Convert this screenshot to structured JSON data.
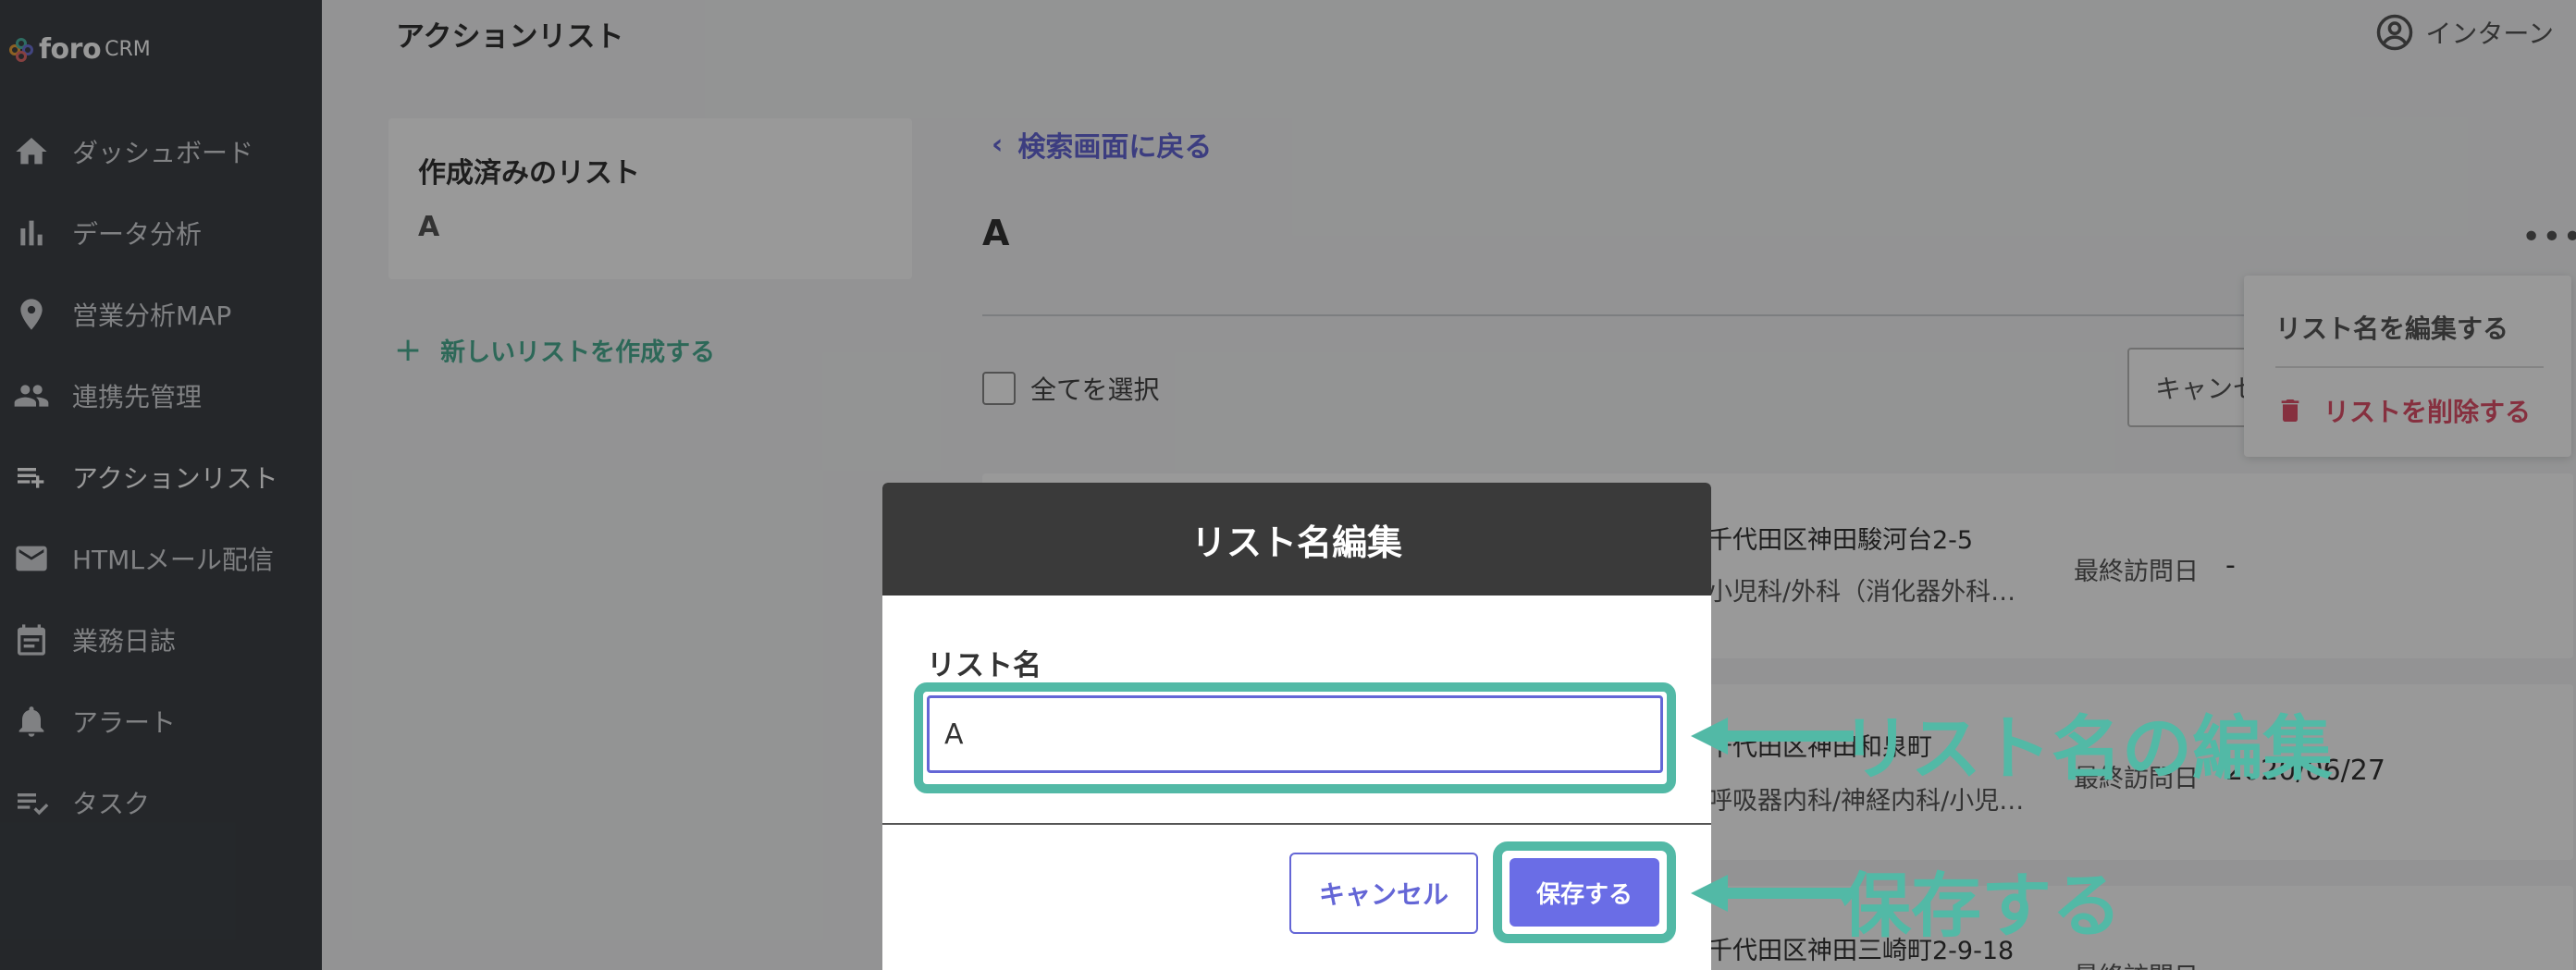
{
  "app": {
    "logo_text": "foro",
    "logo_sub": "CRM"
  },
  "sidebar": {
    "items": [
      {
        "label": "ダッシュボード",
        "icon": "home-icon"
      },
      {
        "label": "データ分析",
        "icon": "bar-chart-icon"
      },
      {
        "label": "営業分析MAP",
        "icon": "map-pin-icon"
      },
      {
        "label": "連携先管理",
        "icon": "people-icon"
      },
      {
        "label": "アクションリスト",
        "icon": "playlist-add-icon"
      },
      {
        "label": "HTMLメール配信",
        "icon": "mail-icon"
      },
      {
        "label": "業務日誌",
        "icon": "calendar-icon"
      },
      {
        "label": "アラート",
        "icon": "bell-icon"
      },
      {
        "label": "タスク",
        "icon": "checklist-icon"
      }
    ]
  },
  "header": {
    "title": "アクションリスト",
    "user": "インターン"
  },
  "left_panel": {
    "title": "作成済みのリスト",
    "item": "A",
    "new_list": "新しいリストを作成する"
  },
  "main": {
    "back": "検索画面に戻る",
    "list_name": "A",
    "more": "•••",
    "select_all": "全てを選択",
    "cancel_partial": "キャンセル"
  },
  "rows": [
    {
      "address": "千代田区神田駿河台2-5",
      "dept": "小児科/外科（消化器外科…",
      "visit_label": "最終訪問日",
      "visit_value": "-"
    },
    {
      "address": "千代田区神田和泉町",
      "dept": "呼吸器内科/神経内科/小児…",
      "visit_label": "最終訪問日",
      "visit_value": "2020/06/27"
    },
    {
      "address": "千代田区神田三崎町2-9-18",
      "visit_label": "最終訪問日"
    }
  ],
  "context_menu": {
    "edit": "リスト名を編集する",
    "delete": "リストを削除する"
  },
  "modal": {
    "title": "リスト名編集",
    "label": "リスト名",
    "value": "A",
    "cancel": "キャンセル",
    "save": "保存する"
  },
  "annotations": {
    "edit": "リスト名の編集",
    "save": "保存する"
  },
  "colors": {
    "accent": "#6466d6",
    "highlight": "#52b9a6",
    "danger": "#e0506a",
    "sidebar": "#3e4247"
  }
}
